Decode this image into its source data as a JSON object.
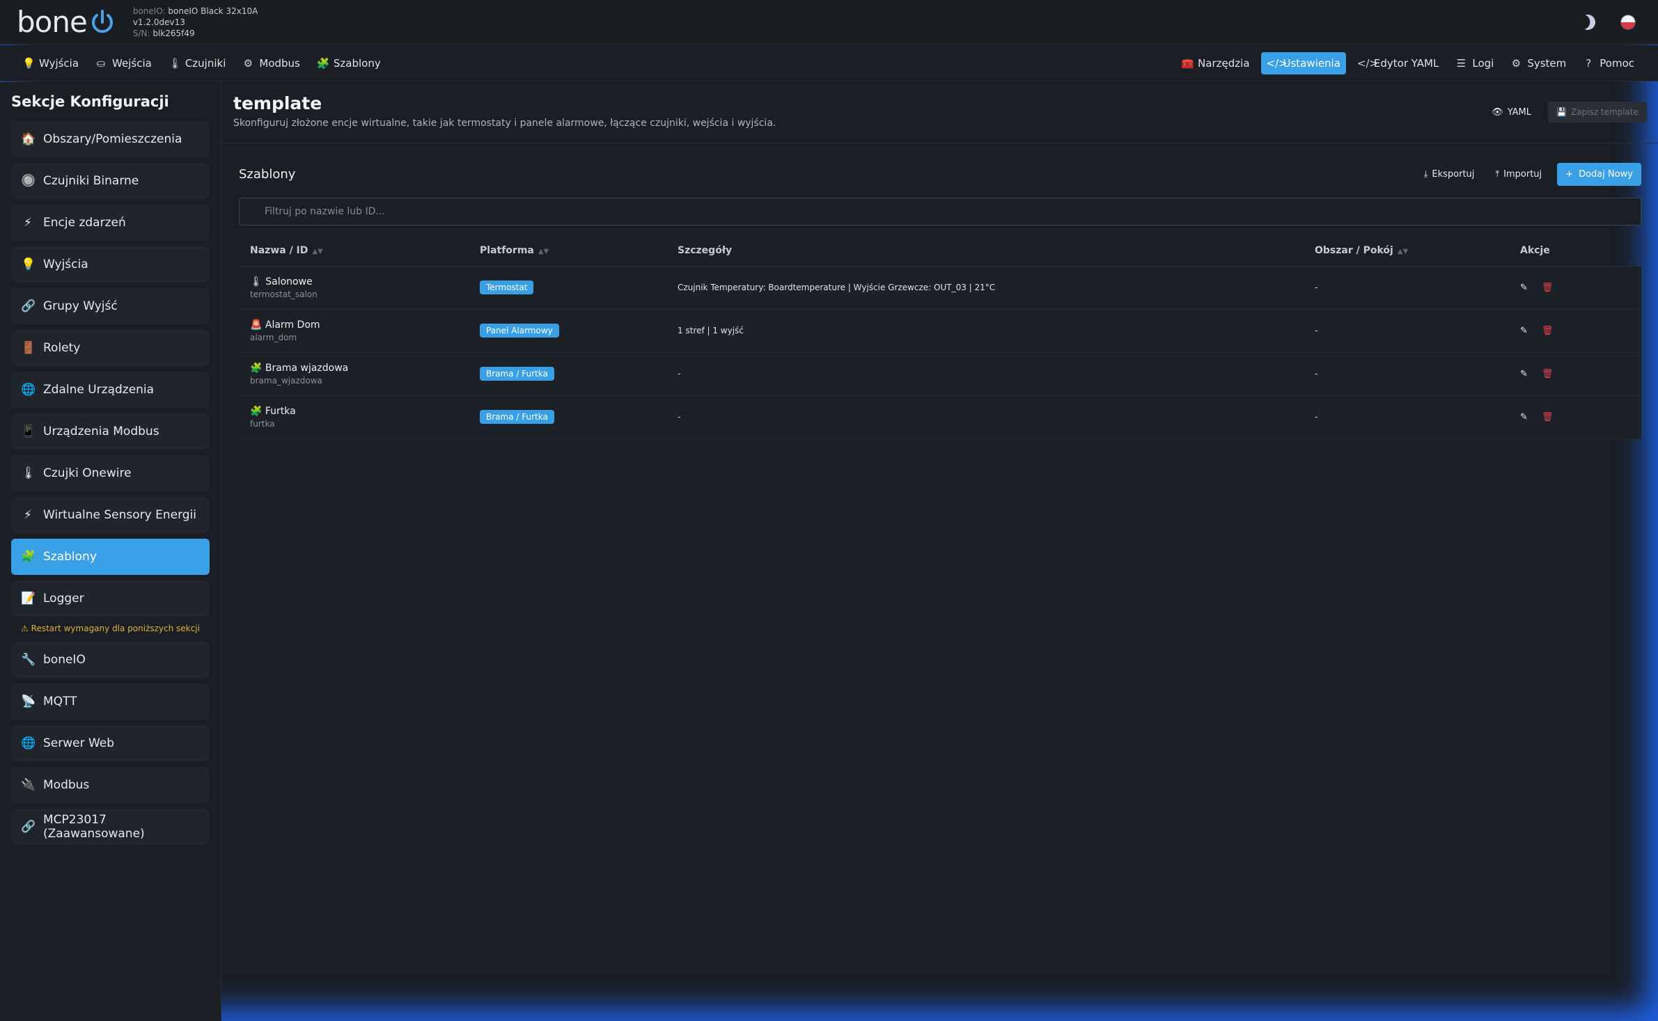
{
  "app": {
    "logo": "bone",
    "logo_icon": "power-icon",
    "device_label": "boneIO:",
    "device_name": "boneIO Black 32x10A",
    "version": "v1.2.0dev13",
    "serial_label": "S/N:",
    "serial": "blk265f49"
  },
  "nav": {
    "left": [
      {
        "icon": "💡",
        "label": "Wyjścia"
      },
      {
        "icon": "⛀",
        "label": "Wejścia"
      },
      {
        "icon": "🌡",
        "label": "Czujniki"
      },
      {
        "icon": "⚙",
        "label": "Modbus"
      },
      {
        "icon": "🧩",
        "label": "Szablony"
      }
    ],
    "right": [
      {
        "icon": "🧰",
        "label": "Narzędzia"
      },
      {
        "icon": "</>",
        "label": "Ustawienia"
      },
      {
        "icon": "</>",
        "label": "Edytor YAML"
      },
      {
        "icon": "☰",
        "label": "Logi"
      },
      {
        "icon": "⚙",
        "label": "System"
      },
      {
        "icon": "?",
        "label": "Pomoc"
      }
    ]
  },
  "sidebar": {
    "title": "Sekcje Konfiguracji",
    "items": [
      {
        "icon": "🏠",
        "label": "Obszary/Pomieszczenia"
      },
      {
        "icon": "🔘",
        "label": "Czujniki Binarne"
      },
      {
        "icon": "⚡",
        "label": "Encje zdarzeń"
      },
      {
        "icon": "💡",
        "label": "Wyjścia"
      },
      {
        "icon": "🔗",
        "label": "Grupy Wyjść"
      },
      {
        "icon": "🚪",
        "label": "Rolety"
      },
      {
        "icon": "🌐",
        "label": "Zdalne Urządzenia"
      },
      {
        "icon": "📱",
        "label": "Urządzenia Modbus"
      },
      {
        "icon": "🌡",
        "label": "Czujki Onewire"
      },
      {
        "icon": "⚡",
        "label": "Wirtualne Sensory Energii"
      },
      {
        "icon": "🧩",
        "label": "Szablony"
      },
      {
        "icon": "📝",
        "label": "Logger"
      }
    ],
    "warning": "⚠ Restart wymagany dla poniższych sekcji",
    "restart_items": [
      {
        "icon": "🔧",
        "label": "boneIO"
      },
      {
        "icon": "📡",
        "label": "MQTT"
      },
      {
        "icon": "🌐",
        "label": "Serwer Web"
      },
      {
        "icon": "🔌",
        "label": "Modbus"
      },
      {
        "icon": "🔗",
        "label": "MCP23017 (Zaawansowane)"
      }
    ]
  },
  "page": {
    "title": "template",
    "subtitle": "Skonfiguruj złożone encje wirtualne, takie jak termostaty i panele alarmowe, łączące czujniki, wejścia i wyjścia.",
    "yaml_btn": "YAML",
    "save_btn": "Zapisz template"
  },
  "card": {
    "title": "Szablony",
    "export_btn": "Eksportuj",
    "import_btn": "Importuj",
    "add_btn": "Dodaj Nowy",
    "filter_placeholder": "Filtruj po nazwie lub ID..."
  },
  "table": {
    "headers": [
      "Nazwa / ID",
      "Platforma",
      "Szczegóły",
      "Obszar / Pokój",
      "Akcje"
    ],
    "rows": [
      {
        "icon": "🌡",
        "name": "Salonowe",
        "id": "termostat_salon",
        "platform": "Termostat",
        "details": "Czujnik Temperatury: Boardtemperature | Wyjście Grzewcze: OUT_03 | 21°C",
        "area": "-"
      },
      {
        "icon": "🚨",
        "name": "Alarm Dom",
        "id": "alarm_dom",
        "platform": "Panel Alarmowy",
        "details": "1 stref | 1 wyjść",
        "area": "-"
      },
      {
        "icon": "🧩",
        "name": "Brama wjazdowa",
        "id": "brama_wjazdowa",
        "platform": "Brama / Furtka",
        "details": "-",
        "area": "-"
      },
      {
        "icon": "🧩",
        "name": "Furtka",
        "id": "furtka",
        "platform": "Brama / Furtka",
        "details": "-",
        "area": "-"
      }
    ]
  },
  "colors": {
    "accent": "#3aa0e6",
    "danger": "#e2434b",
    "warning": "#e0b13b"
  }
}
